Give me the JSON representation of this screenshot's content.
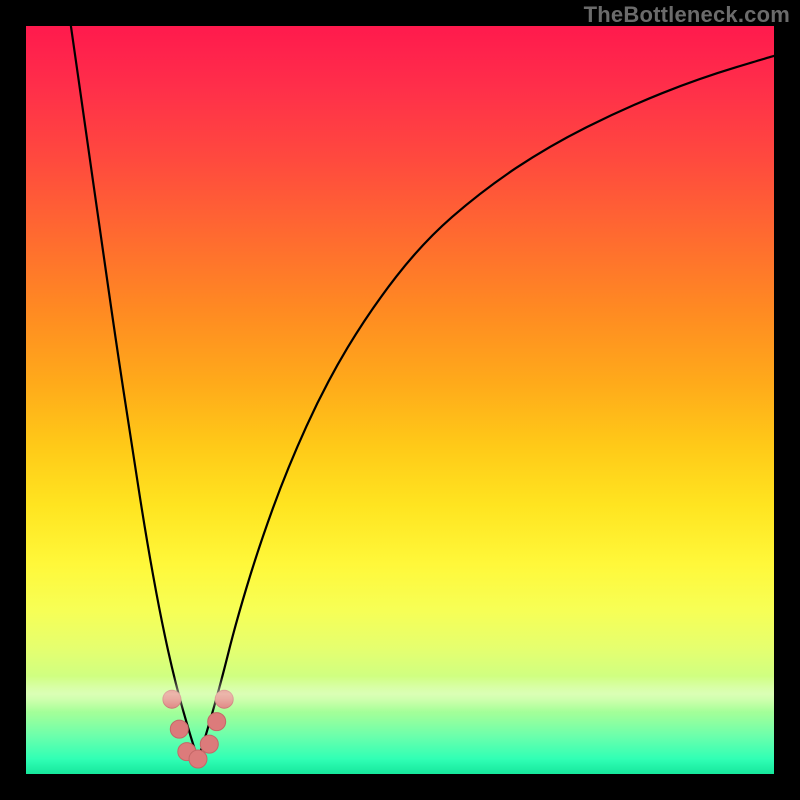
{
  "watermark": "TheBottleneck.com",
  "colors": {
    "curve": "#000000",
    "marker_fill": "#dc7b7b",
    "marker_stroke": "#c46767",
    "frame_bg_top": "#ff1a4d",
    "frame_bg_bottom": "#16e79c"
  },
  "chart_data": {
    "type": "line",
    "title": "",
    "xlabel": "",
    "ylabel": "",
    "xlim": [
      0,
      100
    ],
    "ylim": [
      0,
      100
    ],
    "grid": false,
    "notes": "V-shaped bottleneck curve; minimum (best match) near x≈23. Left branch rises steeply toward top-left corner; right branch rises with decreasing slope toward upper-right. Pink markers cluster around the trough.",
    "series": [
      {
        "name": "bottleneck-curve",
        "x": [
          6,
          8,
          10,
          12,
          14,
          16,
          18,
          20,
          22,
          23,
          24,
          26,
          28,
          31,
          35,
          40,
          46,
          53,
          61,
          70,
          80,
          90,
          100
        ],
        "values": [
          100,
          86,
          72,
          58,
          45,
          32,
          21,
          12,
          5,
          2,
          5,
          12,
          20,
          30,
          41,
          52,
          62,
          71,
          78,
          84,
          89,
          93,
          96
        ]
      }
    ],
    "markers": [
      {
        "x": 19.5,
        "y": 10
      },
      {
        "x": 20.5,
        "y": 6
      },
      {
        "x": 21.5,
        "y": 3
      },
      {
        "x": 23.0,
        "y": 2
      },
      {
        "x": 24.5,
        "y": 4
      },
      {
        "x": 25.5,
        "y": 7
      },
      {
        "x": 26.5,
        "y": 10
      }
    ]
  }
}
